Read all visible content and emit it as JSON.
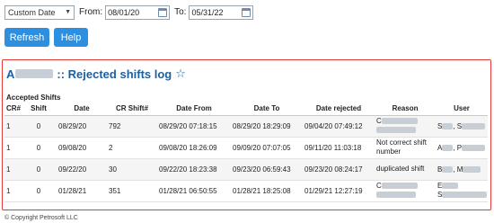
{
  "filters": {
    "period": "Custom Date",
    "from_label": "From:",
    "from_value": "08/01/20",
    "to_label": "To:",
    "to_value": "05/31/22"
  },
  "buttons": {
    "refresh": "Refresh",
    "help": "Help"
  },
  "report": {
    "title_initial": "A",
    "title_suffix": ":: Rejected shifts log",
    "section": "Accepted Shifts",
    "columns": [
      "CR#",
      "Shift",
      "Date",
      "CR Shift#",
      "Date From",
      "Date To",
      "Date rejected",
      "Reason",
      "User"
    ],
    "rows": [
      {
        "cr": "1",
        "shift": "0",
        "date": "08/29/20",
        "cr_shift": "792",
        "date_from": "08/29/20 07:18:15",
        "date_to": "08/29/20 18:29:09",
        "date_rejected": "09/04/20 07:49:12",
        "reason_prefix": "C",
        "reason_text": "",
        "user_first": "S",
        "user_last": ", S"
      },
      {
        "cr": "1",
        "shift": "0",
        "date": "09/08/20",
        "cr_shift": "2",
        "date_from": "09/08/20 18:26:09",
        "date_to": "09/09/20 07:07:05",
        "date_rejected": "09/11/20 11:03:18",
        "reason_prefix": "",
        "reason_text": "Not correct shift number",
        "user_first": "A",
        "user_last": ", P"
      },
      {
        "cr": "1",
        "shift": "0",
        "date": "09/22/20",
        "cr_shift": "30",
        "date_from": "09/22/20 18:23:38",
        "date_to": "09/23/20 06:59:43",
        "date_rejected": "09/23/20 08:24:17",
        "reason_prefix": "",
        "reason_text": "duplicated shift",
        "user_first": "B",
        "user_last": ", M"
      },
      {
        "cr": "1",
        "shift": "0",
        "date": "01/28/21",
        "cr_shift": "351",
        "date_from": "01/28/21 06:50:55",
        "date_to": "01/28/21 18:25:08",
        "date_rejected": "01/29/21 12:27:19",
        "reason_prefix": "C",
        "reason_text": "",
        "user_first": "E",
        "user_last": "S"
      }
    ]
  },
  "footer": "© Copyright Petrosoft LLC"
}
